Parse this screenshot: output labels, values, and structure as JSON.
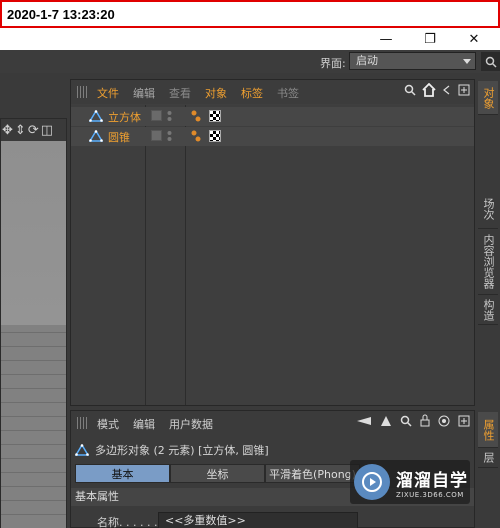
{
  "timestamp": "2020-1-7  13:23:20",
  "window": {
    "minimize": "—",
    "restore": "❐",
    "close": "✕"
  },
  "layout": {
    "label": "界面:",
    "value": "启动"
  },
  "object_manager": {
    "menus": [
      "文件",
      "编辑",
      "查看",
      "对象",
      "标签",
      "书签"
    ],
    "objects": [
      {
        "name": "立方体"
      },
      {
        "name": "圆锥"
      }
    ]
  },
  "right_tabs": [
    "对象",
    "场次",
    "内容浏览器",
    "构造"
  ],
  "right_tabs_lower": [
    "属性",
    "层"
  ],
  "attributes": {
    "menus": [
      "模式",
      "编辑",
      "用户数据"
    ],
    "title": "多边形对象 (2 元素) [立方体, 圆锥]",
    "tabs": [
      "基本",
      "坐标",
      "平滑着色(Phong)"
    ],
    "section": "基本属性",
    "field_label": "名称. . . . . . .",
    "field_value": "<<多重数值>>"
  },
  "watermark": {
    "brand": "溜溜自学",
    "url": "ZIXUE.3D66.COM"
  },
  "colors": {
    "accent_orange": "#f0a030",
    "active_tab": "#7a9cc6",
    "timestamp_border": "#e00000"
  }
}
